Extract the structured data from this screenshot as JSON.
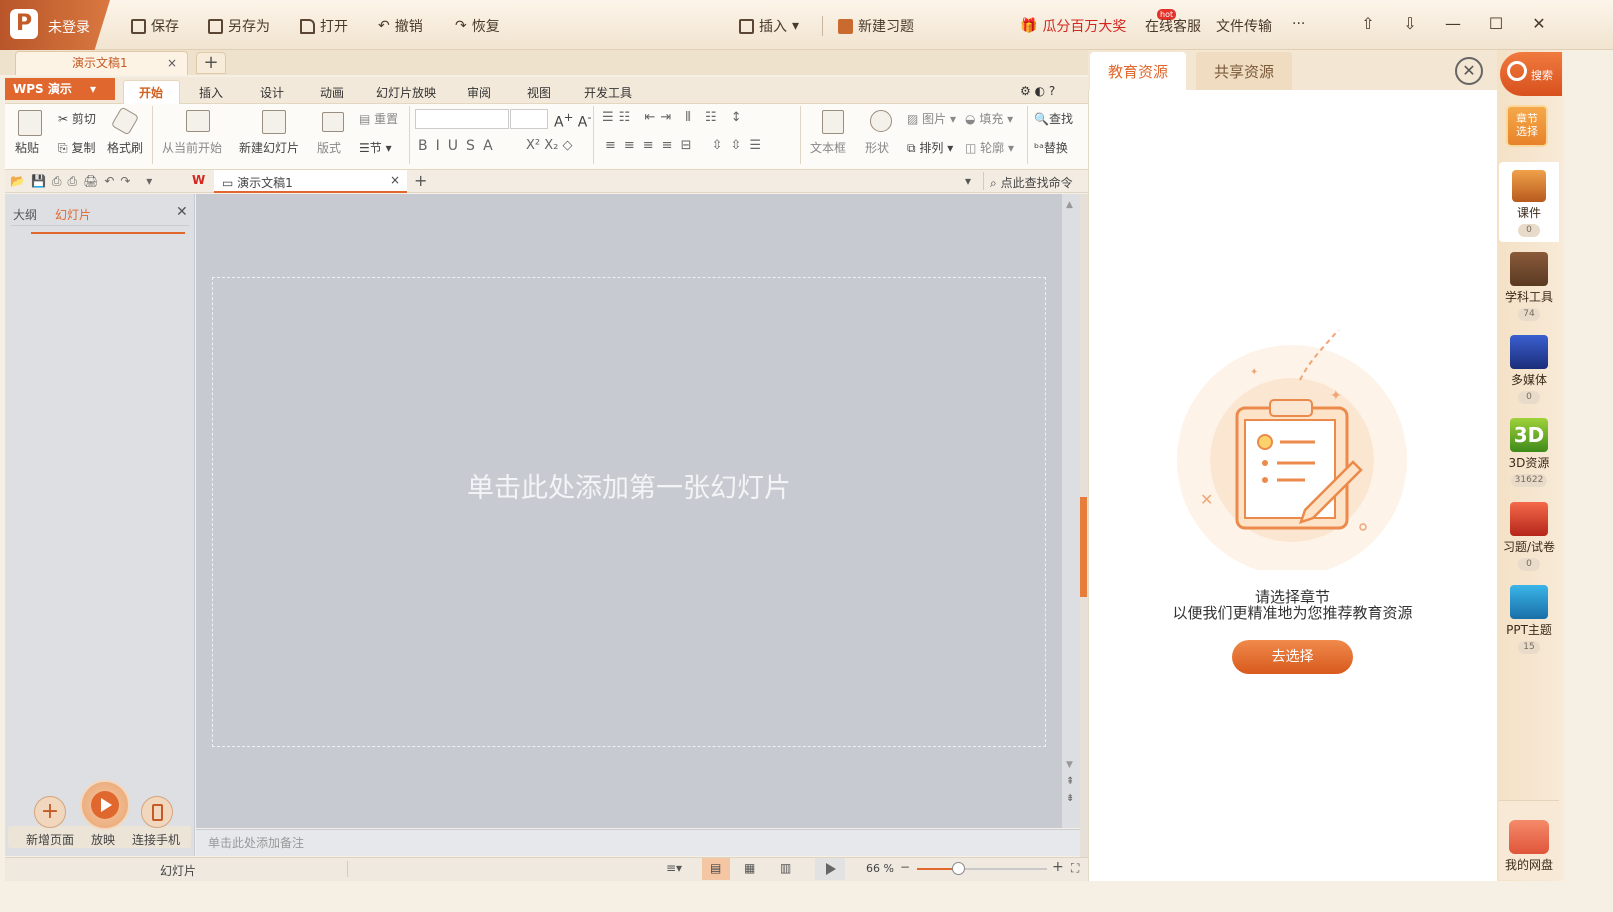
{
  "titlebar": {
    "login": "未登录",
    "save": "保存",
    "save_as": "另存为",
    "open": "打开",
    "undo": "撤销",
    "redo": "恢复",
    "insert": "插入",
    "new_exercise": "新建习题",
    "promo": "瓜分百万大奖",
    "hot": "hot",
    "service": "在线客服",
    "transfer": "文件传输",
    "more": "···"
  },
  "doc_tab": {
    "name": "演示文稿1",
    "close": "×",
    "new": "+"
  },
  "ribbon_tabs": {
    "menu": "WPS 演示",
    "tabs": [
      "开始",
      "插入",
      "设计",
      "动画",
      "幻灯片放映",
      "审阅",
      "视图",
      "开发工具"
    ]
  },
  "ribbon": {
    "paste": "粘贴",
    "cut": "剪切",
    "copy": "复制",
    "format_painter": "格式刷",
    "from_current": "从当前开始",
    "new_slide": "新建幻灯片",
    "layout": "版式",
    "reset": "重置",
    "section": "节",
    "textbox": "文本框",
    "shape": "形状",
    "picture": "图片",
    "arrange": "排列",
    "fill": "填充",
    "outline": "轮廓",
    "find": "查找",
    "replace": "替换"
  },
  "qat": {
    "doc_name": "演示文稿1",
    "command_search": "点此查找命令"
  },
  "left_pane": {
    "outline_tab": "大纲",
    "slides_tab": "幻灯片",
    "new_page": "新增页面",
    "play": "放映",
    "connect_phone": "连接手机"
  },
  "canvas": {
    "slide_hint": "单击此处添加第一张幻灯片",
    "notes_placeholder": "单击此处添加备注"
  },
  "status": {
    "label": "幻灯片",
    "zoom": "66 %"
  },
  "right_panel": {
    "tab_edu": "教育资源",
    "tab_share": "共享资源",
    "message_line1": "请选择章节",
    "message_line2": "以便我们更精准地为您推荐教育资源",
    "button": "去选择"
  },
  "sidebar": {
    "search": "搜索",
    "chapter_select": "章节选择",
    "items": [
      {
        "label": "课件",
        "count": "0"
      },
      {
        "label": "学科工具",
        "count": "74"
      },
      {
        "label": "多媒体",
        "count": "0"
      },
      {
        "label": "3D资源",
        "count": "31622"
      },
      {
        "label": "习题/试卷",
        "count": "0"
      },
      {
        "label": "PPT主题",
        "count": "15"
      }
    ],
    "cloud": "我的网盘"
  },
  "colors": {
    "accent": "#e0682e",
    "canvas": "#c7cad1",
    "brand_red": "#d2261f"
  }
}
